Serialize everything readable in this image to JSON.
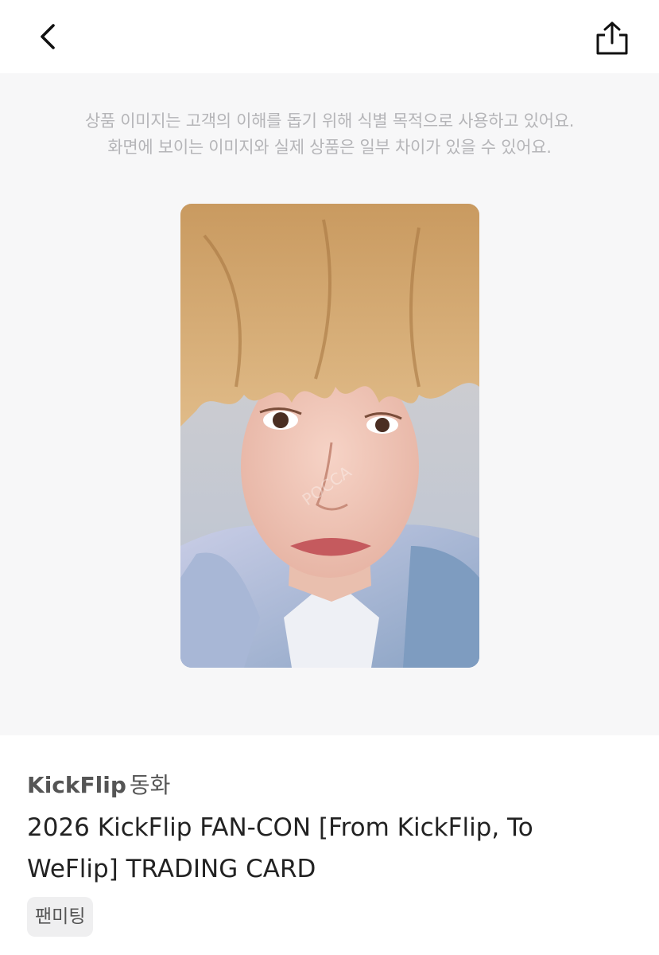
{
  "header": {
    "back_icon": "chevron-left-icon",
    "share_icon": "share-icon"
  },
  "notice": {
    "line1": "상품 이미지는 고객의 이해를 돕기 위해 식별 목적으로 사용하고 있어요.",
    "line2": "화면에 보이는 이미지와 실제 상품은 일부 차이가 있을 수 있어요."
  },
  "product": {
    "image_watermark": "POCCA",
    "artist": "KickFlip",
    "member": "동화",
    "title": "2026 KickFlip FAN-CON [From KickFlip, To WeFlip] TRADING CARD",
    "tag": "팬미팅"
  },
  "colors": {
    "background": "#ffffff",
    "image_area_bg": "#f7f7f8",
    "notice_text": "#b5b5b8",
    "tag_bg": "#efeff0"
  }
}
